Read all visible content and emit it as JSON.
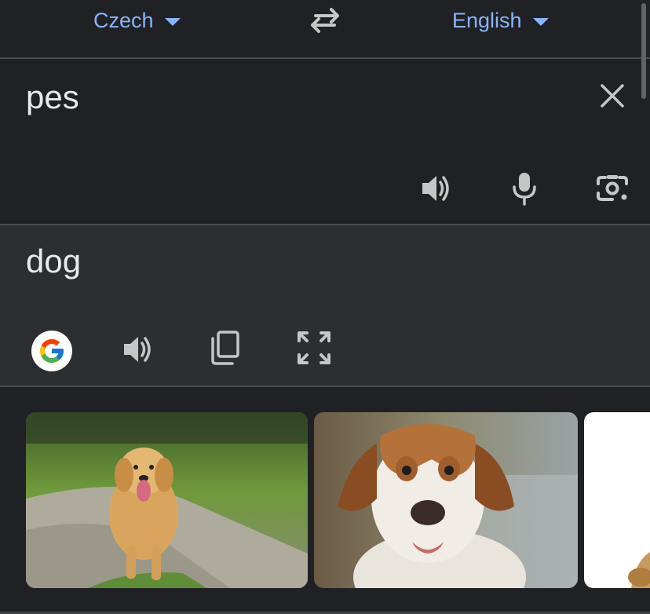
{
  "languages": {
    "source": "Czech",
    "target": "English"
  },
  "source": {
    "text": "pes"
  },
  "translation": {
    "text": "dog"
  },
  "icons": {
    "swap": "swap-icon",
    "clear": "close-icon",
    "listen_source": "speaker-icon",
    "voice_input": "microphone-icon",
    "camera": "camera-lens-icon",
    "google": "google-logo-icon",
    "listen_translation": "speaker-icon",
    "copy": "copy-icon",
    "fullscreen": "expand-icon"
  },
  "images": [
    {
      "subject": "golden-retriever-running"
    },
    {
      "subject": "brown-white-dog-portrait"
    },
    {
      "subject": "dog-partial"
    }
  ],
  "colors": {
    "background": "#202124",
    "translation_panel": "#2d2e31",
    "accent": "#8ab4f8",
    "icon": "#c4c7c5",
    "text": "#e8eaed"
  }
}
